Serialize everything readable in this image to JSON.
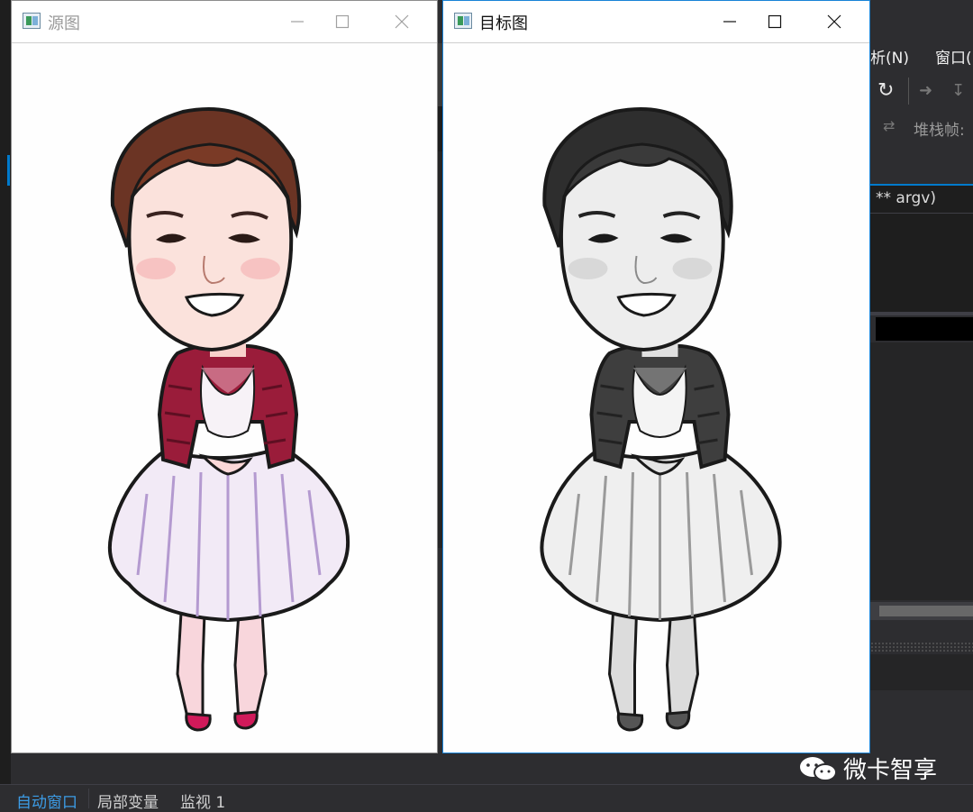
{
  "ide": {
    "menu_analyze": "析(N)",
    "menu_window": "窗口(",
    "stack_frame_label": "堆栈帧:",
    "code_fragment": "** argv)"
  },
  "windows": {
    "source": {
      "title": "源图",
      "image": "color cartoon caricature of a woman in red jacket and white tutu skirt"
    },
    "target": {
      "title": "目标图",
      "image": "grayscale version of the same cartoon caricature"
    }
  },
  "bottom_tabs": [
    {
      "label": "自动窗口",
      "active": true
    },
    {
      "label": "局部变量",
      "active": false
    },
    {
      "label": "监视 1",
      "active": false
    }
  ],
  "watermark": {
    "text": "微卡智享",
    "icon": "wechat-icon"
  },
  "colors": {
    "ide_bg": "#2d2d30",
    "active_tab": "#3c9ce6",
    "active_window_border": "#1883d7",
    "hair_src": "#6b3424",
    "jacket_src": "#9a1c3a",
    "skirt_src": "#f2eaf6",
    "shoes_src": "#d01a5a"
  }
}
